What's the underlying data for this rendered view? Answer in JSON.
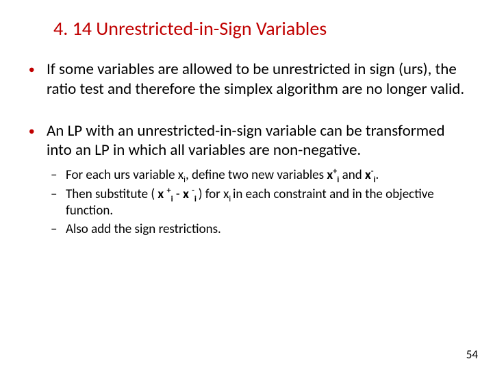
{
  "title": "4. 14 Unrestricted-in-Sign Variables",
  "bullets": {
    "b1": "If some variables are allowed to be unrestricted in sign (urs), the ratio test and therefore the simplex algorithm are no longer valid.",
    "b2": "An LP with an unrestricted-in-sign variable can be transformed into an LP in which all variables are non-negative.",
    "sub1_pre": "For each urs variable x",
    "sub1_mid1": ", define two new variables ",
    "sub1_bold1_pre": "x",
    "sub1_bold1_sup": "+",
    "sub1_bold1_sub": "i",
    "sub1_and": " and ",
    "sub1_bold2_pre": "x",
    "sub1_bold2_sup": "-",
    "sub1_bold2_sub": "i",
    "sub1_end": ".",
    "sub2_pre": "Then substitute ( ",
    "sub2_b1_pre": "x ",
    "sub2_b1_sup": "+",
    "sub2_b1_sub": "i",
    "sub2_mid": "  - ",
    "sub2_b2_pre": "x ",
    "sub2_b2_sup": "-",
    "sub2_b2_sub": "i ",
    "sub2_after": ") for x",
    "sub2_sub": "i ",
    "sub2_end": "in each constraint and in the objective function.",
    "sub3": "Also add the sign restrictions.",
    "i_sub": "i"
  },
  "page": "54"
}
